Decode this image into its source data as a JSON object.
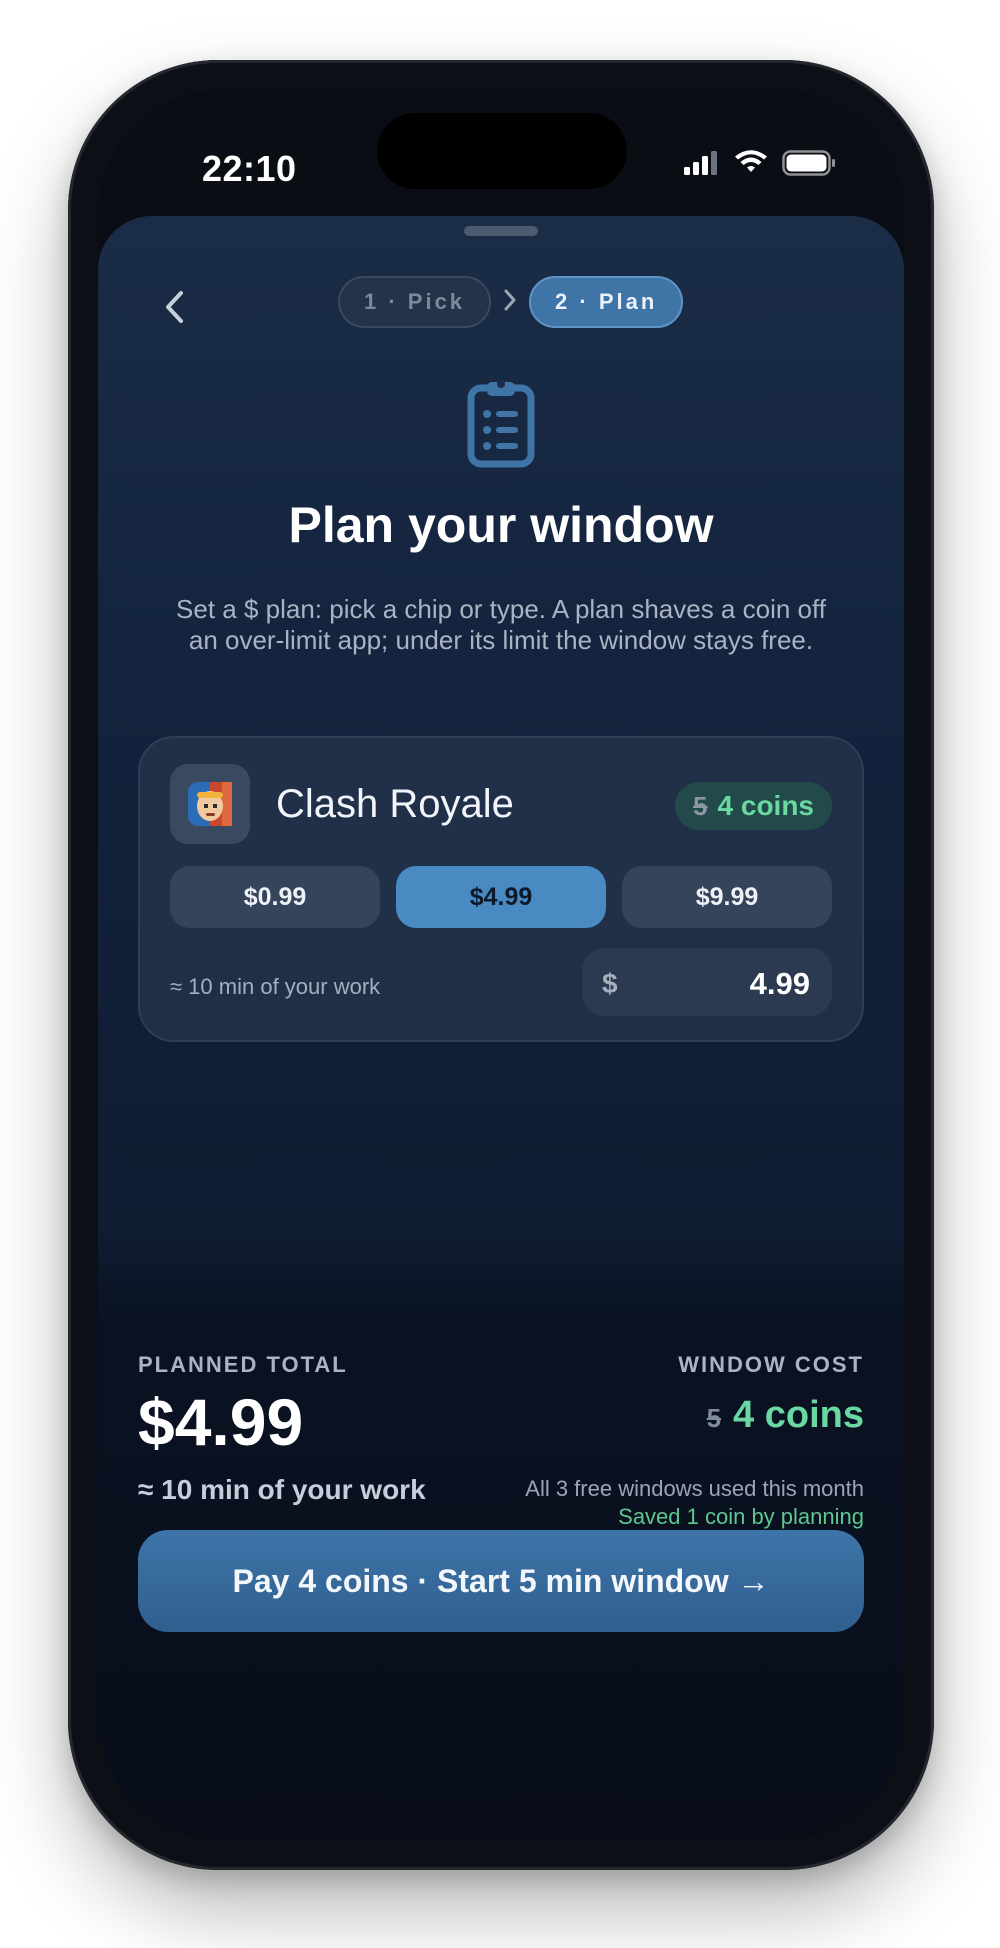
{
  "status_bar": {
    "time": "22:10"
  },
  "nav": {
    "back_icon": "chevron-left-icon",
    "steps": [
      {
        "label": "1 · Pick",
        "active": false
      },
      {
        "label": "2 · Plan",
        "active": true
      }
    ],
    "step_separator_icon": "chevron-right-icon"
  },
  "hero": {
    "icon": "clipboard-list-icon",
    "title": "Plan your window",
    "subtitle": "Set a $ plan: pick a chip or type. A plan shaves a coin off an over-limit app; under its limit the window stays free."
  },
  "app_card": {
    "app_name": "Clash Royale",
    "coin_old": "5",
    "coin_new": "4 coins",
    "chips": [
      {
        "label": "$0.99",
        "selected": false
      },
      {
        "label": "$4.99",
        "selected": true
      },
      {
        "label": "$9.99",
        "selected": false
      }
    ],
    "work_note": "≈ 10 min of your work",
    "amount_currency": "$",
    "amount_value": "4.99"
  },
  "summary": {
    "planned_label": "PLANNED TOTAL",
    "planned_amount": "$4.99",
    "planned_work": "≈ 10 min of your work",
    "cost_label": "WINDOW COST",
    "cost_old": "5",
    "cost_new": "4 coins",
    "free_note": "All 3 free windows used this month",
    "saved_note": "Saved 1 coin by planning"
  },
  "cta": {
    "label": "Pay 4 coins · Start 5 min window →"
  },
  "colors": {
    "accent": "#4a8ac2",
    "success": "#6ad8a3",
    "background": "#0f1d33"
  }
}
